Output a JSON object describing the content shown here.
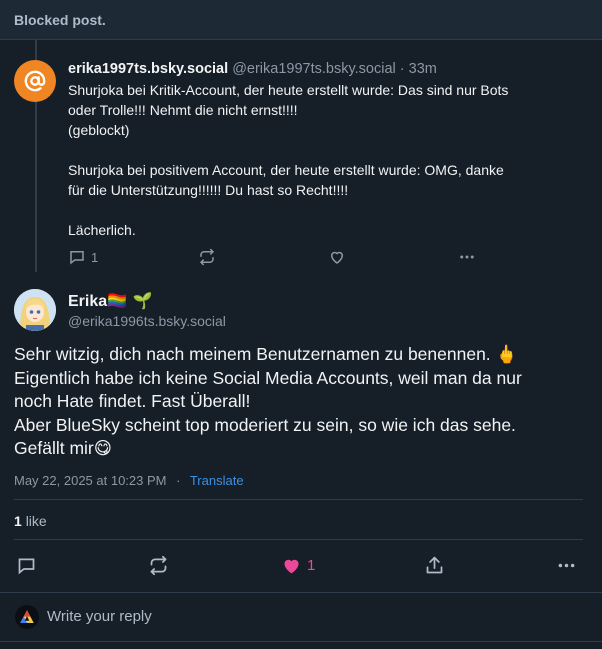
{
  "blocked_banner": "Blocked post.",
  "parent_post": {
    "display_name": "erika1997ts.bsky.social",
    "handle": "@erika1997ts.bsky.social",
    "time": "· 33m",
    "text": "Shurjoka bei Kritik-Account, der heute erstellt wurde: Das sind nur Bots\noder Trolle!!! Nehmt die nicht ernst!!!!\n(geblockt)\n\nShurjoka bei positivem Account, der heute erstellt wurde: OMG, danke\nfür die Unterstützung!!!!!! Du hast so Recht!!!!\n\nLächerlich.",
    "reply_count": "1",
    "avatar_icon": "at-sign-icon",
    "avatar_color": "#f08523"
  },
  "main_post": {
    "display_name": "Erika",
    "name_emoji": "🏳️‍🌈 🌱",
    "handle": "@erika1996ts.bsky.social",
    "lines": [
      "Sehr witzig, dich nach meinem Benutzernamen zu benennen. 🖕",
      "Eigentlich habe ich keine Social Media Accounts, weil man da nur",
      "noch Hate findet. Fast Überall!",
      "Aber BlueSky scheint top moderiert zu sein, so wie ich das sehe.",
      "Gefällt mir😋"
    ],
    "timestamp": "May 22, 2025 at 10:23 PM",
    "separator": "·",
    "translate_label": "Translate",
    "like_count_bold": "1",
    "like_word": "like",
    "like_action_count": "1",
    "like_color": "#ec4899"
  },
  "reply_bar": {
    "placeholder": "Write your reply"
  },
  "colors": {
    "background": "#161e27",
    "muted": "#8b98a5",
    "link": "#3d8fe6"
  }
}
